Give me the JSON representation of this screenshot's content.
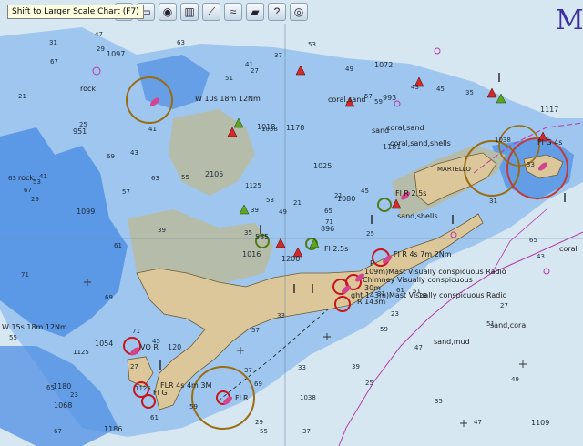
{
  "toolbar": {
    "tooltip": "Shift to Larger Scale Chart (F7)",
    "buttons": [
      {
        "name": "chart-bar-icon",
        "glyph": "▤"
      },
      {
        "name": "folder-icon",
        "glyph": "▭"
      },
      {
        "name": "compass-icon",
        "glyph": "◉"
      },
      {
        "name": "print-icon",
        "glyph": "▥"
      },
      {
        "name": "route-icon",
        "glyph": "⟋"
      },
      {
        "name": "track-icon",
        "glyph": "≈"
      },
      {
        "name": "layers-icon",
        "glyph": "▰"
      },
      {
        "name": "help-icon",
        "glyph": "?"
      },
      {
        "name": "lifebuoy-icon",
        "glyph": "◎"
      }
    ]
  },
  "chart_labels": {
    "rock_1": "rock",
    "rock_2": "rock",
    "coral_sand_1": "coral,sand",
    "coral_sand_shells": "coral,sand,shells",
    "coral_sand_2": "coral,sand",
    "martello": "MARTELLO",
    "sand_1": "sand",
    "sand_shells": "sand,shells",
    "sand_coral": "sand,coral",
    "sand_mud": "sand,mud",
    "coral_right": "coral",
    "light_top": "W 10s 18m 12Nm",
    "light_left": "W 15s 18m 12Nm",
    "fl_r_1": "Fl R 2.5s",
    "fl_r_2": "Fl R 4s 7m 2Nm",
    "chimney": "Chimney Visually conspicuous",
    "radio_1": "109m)Mast Visually conspicuous Radio",
    "radio_2": "ght 143m)Mast Visually conspicuous Radio",
    "fl_r_left": "FLR 4s 4m 3M",
    "fl_r_small": "Fl G",
    "fl_r_bottom": "FLR",
    "vq_r": "VQ R",
    "depth_30": "30m",
    "r_143": "R 143m",
    "fl_2": "Fl 2.5s",
    "fl_g_top": "Fl G 4s",
    "p_label": "P",
    "scale_glyph": "M"
  },
  "depths": [
    "1200",
    "951",
    "585",
    "1180",
    "1080",
    "120",
    "1072",
    "1178",
    "993",
    "896",
    "1097",
    "1109",
    "1099",
    "1117",
    "1016",
    "1181",
    "1186",
    "1018",
    "1025",
    "1054",
    "2105",
    "1068",
    "1125",
    "1038",
    "21",
    "23",
    "25",
    "27",
    "29",
    "31",
    "33",
    "35",
    "37",
    "39",
    "41",
    "43",
    "45",
    "47",
    "49",
    "51",
    "53",
    "55",
    "57",
    "59",
    "61",
    "63",
    "65",
    "67",
    "69",
    "71"
  ],
  "colors": {
    "deep_water": "#d7e7f2",
    "shallow": "#9ec6ee",
    "very_shallow": "#4f8fe3",
    "land": "#dcc79a",
    "drying": "#b5bca9",
    "magenta": "#b63aa8"
  }
}
